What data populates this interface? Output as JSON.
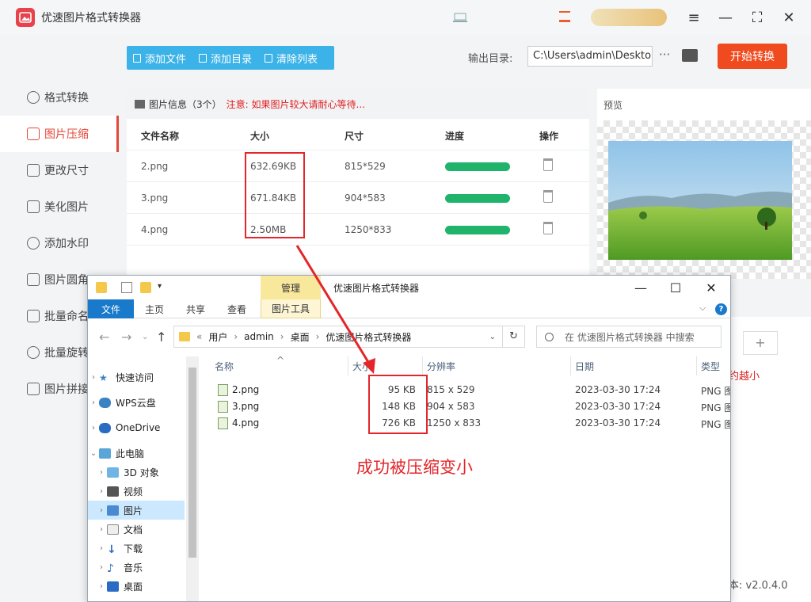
{
  "app": {
    "title": "优速图片格式转换器",
    "vip_label": "",
    "window_controls": [
      "menu-icon",
      "minimize-icon",
      "fullscreen-icon",
      "close-icon"
    ]
  },
  "sidebar": {
    "items": [
      {
        "label": "格式转换",
        "icon": "convert-icon"
      },
      {
        "label": "图片压缩",
        "icon": "compress-icon",
        "active": true
      },
      {
        "label": "更改尺寸",
        "icon": "resize-icon"
      },
      {
        "label": "美化图片",
        "icon": "beautify-icon"
      },
      {
        "label": "添加水印",
        "icon": "watermark-icon"
      },
      {
        "label": "图片圆角",
        "icon": "round-corner-icon"
      },
      {
        "label": "批量命名",
        "icon": "rename-icon"
      },
      {
        "label": "批量旋转",
        "icon": "rotate-icon"
      },
      {
        "label": "图片拼接",
        "icon": "stitch-icon"
      }
    ]
  },
  "toolbar": {
    "add_file": "添加文件",
    "add_dir": "添加目录",
    "clear_list": "清除列表",
    "output_label": "输出目录:",
    "output_path": "C:\\Users\\admin\\Deskto",
    "more": "···",
    "start": "开始转换"
  },
  "file_panel": {
    "title": "图片信息（3个）",
    "warning": "注意: 如果图片较大请耐心等待...",
    "columns": [
      "文件名称",
      "大小",
      "尺寸",
      "进度",
      "操作"
    ],
    "rows": [
      {
        "name": "2.png",
        "size": "632.69KB",
        "dims": "815*529",
        "progress": 1.0
      },
      {
        "name": "3.png",
        "size": "671.84KB",
        "dims": "904*583",
        "progress": 1.0
      },
      {
        "name": "4.png",
        "size": "2.50MB",
        "dims": "1250*833",
        "progress": 1.0
      }
    ]
  },
  "preview": {
    "title": "预览"
  },
  "right_lower": {
    "hint": "约越小",
    "version": "本: v2.0.4.0"
  },
  "explorer": {
    "title": "优速图片格式转换器",
    "manage_tab": "管理",
    "ribbon_tabs": [
      "文件",
      "主页",
      "共享",
      "查看"
    ],
    "tools_tab": "图片工具",
    "breadcrumb": [
      "用户",
      "admin",
      "桌面",
      "优速图片格式转换器"
    ],
    "search_placeholder": "在 优速图片格式转换器 中搜索",
    "nav": [
      {
        "label": "快速访问",
        "icon": "star-icon"
      },
      {
        "label": "WPS云盘",
        "icon": "cloud-icon"
      },
      {
        "label": "OneDrive",
        "icon": "onedrive-icon"
      },
      {
        "label": "此电脑",
        "icon": "pc-icon"
      },
      {
        "label": "3D 对象",
        "icon": "cube-icon"
      },
      {
        "label": "视频",
        "icon": "video-icon"
      },
      {
        "label": "图片",
        "icon": "picture-icon"
      },
      {
        "label": "文档",
        "icon": "document-icon"
      },
      {
        "label": "下载",
        "icon": "download-icon"
      },
      {
        "label": "音乐",
        "icon": "music-icon"
      },
      {
        "label": "桌面",
        "icon": "desktop-icon"
      }
    ],
    "columns": [
      "名称",
      "大小",
      "分辨率",
      "日期",
      "类型"
    ],
    "files": [
      {
        "name": "2.png",
        "size": "95 KB",
        "res": "815 x 529",
        "date": "2023-03-30 17:24",
        "type": "PNG 图"
      },
      {
        "name": "3.png",
        "size": "148 KB",
        "res": "904 x 583",
        "date": "2023-03-30 17:24",
        "type": "PNG 图"
      },
      {
        "name": "4.png",
        "size": "726 KB",
        "res": "1250 x 833",
        "date": "2023-03-30 17:24",
        "type": "PNG 图"
      }
    ]
  },
  "annotation": {
    "text": "成功被压缩变小",
    "color": "#e3262a"
  }
}
